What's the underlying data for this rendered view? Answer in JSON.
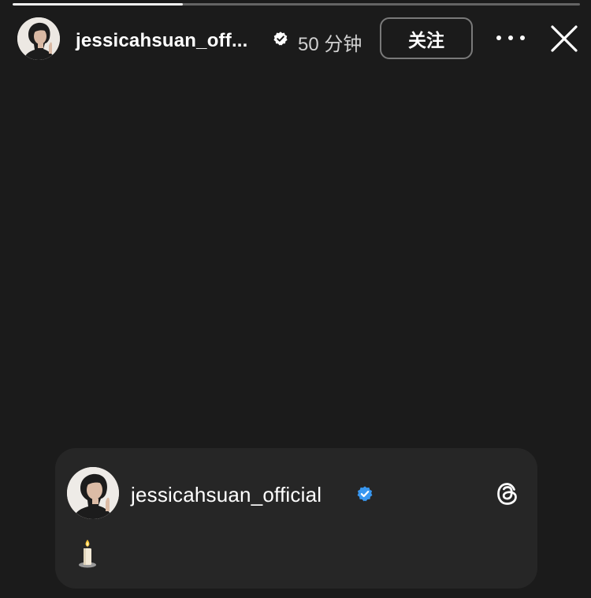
{
  "story": {
    "progress_fraction": 0.3
  },
  "header": {
    "username": "jessicahsuan_off...",
    "verified_icon": "verified-badge-icon",
    "time_ago": "50 分钟",
    "follow_label": "关注",
    "more_icon": "more-horizontal-icon",
    "close_icon": "close-icon"
  },
  "card": {
    "username": "jessicahsuan_official",
    "verified_icon": "verified-badge-icon",
    "verified_color": "#3897f0",
    "threads_icon": "threads-logo-icon",
    "emoji_icon": "candle-icon"
  },
  "colors": {
    "background": "#1b1b1b",
    "card_background": "#262626",
    "text_primary": "#ffffff",
    "text_secondary": "#d0d0d0",
    "button_border": "#7a7a7a"
  }
}
